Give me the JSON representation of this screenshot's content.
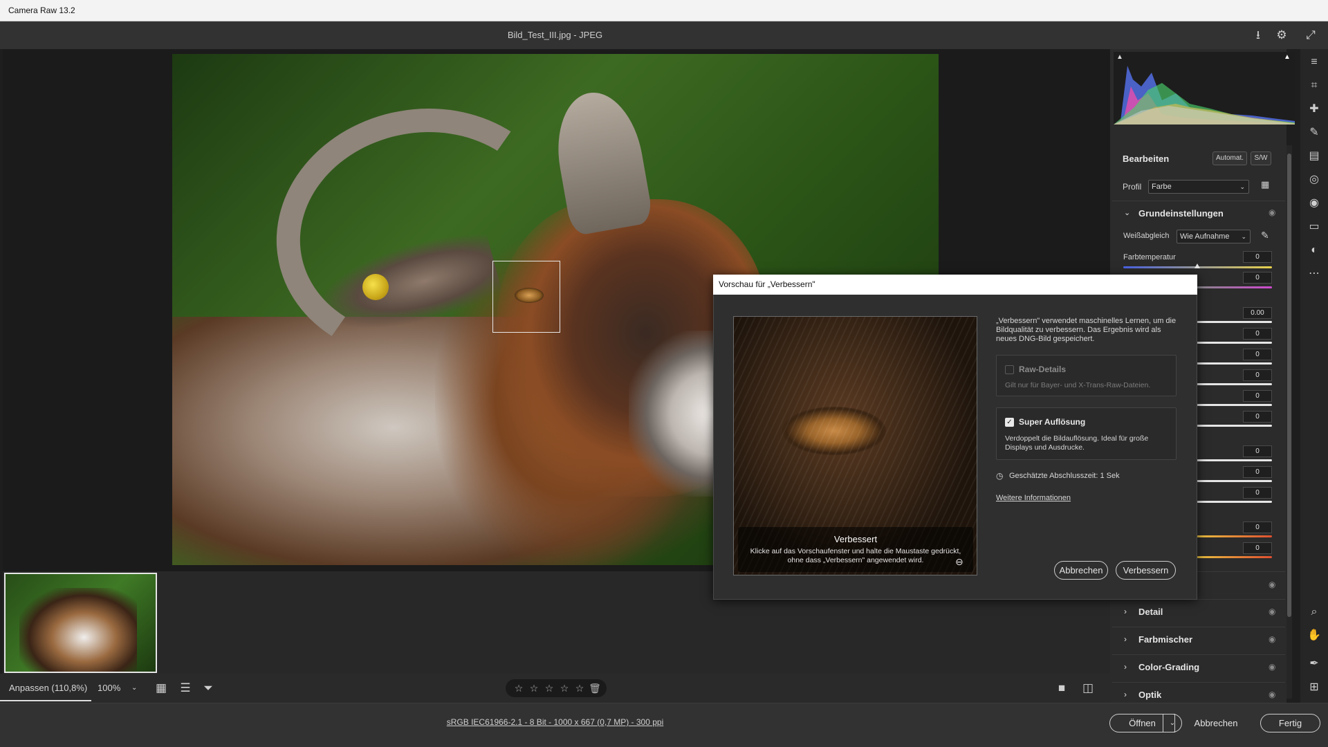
{
  "window": {
    "title": "Camera Raw 13.2"
  },
  "header": {
    "filename": "Bild_Test_III.jpg  -  JPEG",
    "icons": [
      "save-icon",
      "gear-icon",
      "fullscreen-icon"
    ]
  },
  "bottombar": {
    "zoom_fit": "Anpassen (110,8%)",
    "zoom_level": "100%",
    "stars": [
      "☆",
      "☆",
      "☆",
      "☆",
      "☆"
    ]
  },
  "footer": {
    "file_info": "sRGB IEC61966-2.1 - 8 Bit - 1000 x 667 (0,7 MP) - 300 ppi",
    "open_label": "Öffnen",
    "cancel_label": "Abbrechen",
    "done_label": "Fertig"
  },
  "panel": {
    "edit_title": "Bearbeiten",
    "auto_label": "Automat.",
    "bw_label": "S/W",
    "profile_label": "Profil",
    "profile_value": "Farbe",
    "basic_section": "Grundeinstellungen",
    "wb_label": "Weißabgleich",
    "wb_value": "Wie Aufnahme",
    "temp_label": "Farbtemperatur",
    "values": [
      "0",
      "0",
      "0.00",
      "0",
      "0",
      "0",
      "0",
      "0",
      "0",
      "0",
      "0",
      "0",
      "0"
    ],
    "curve_partial": "ve",
    "sections": [
      "Detail",
      "Farbmischer",
      "Color-Grading",
      "Optik"
    ]
  },
  "dialog": {
    "title": "Vorschau für „Verbessern\"",
    "description": "„Verbessern\" verwendet maschinelles Lernen, um die Bildqualität zu verbessern. Das Ergebnis wird als neues DNG-Bild gespeichert.",
    "raw_details_title": "Raw-Details",
    "raw_details_desc": "Gilt nur für Bayer- und X-Trans-Raw-Dateien.",
    "super_res_title": "Super Auflösung",
    "super_res_desc": "Verdoppelt die Bildauflösung. Ideal für große Displays und Ausdrucke.",
    "estimated_time": "Geschätzte Abschlusszeit: 1 Sek",
    "more_info": "Weitere Informationen",
    "preview_caption_title": "Verbessert",
    "preview_caption_body": "Klicke auf das Vorschaufenster und halte die Maustaste gedrückt, ohne dass „Verbessern\" angewendet wird.",
    "cancel_label": "Abbrechen",
    "enhance_label": "Verbessern",
    "raw_details_checked": false,
    "super_res_checked": true
  },
  "colors": {
    "accent": "#e6e6e6",
    "panel_bg": "#2b2b2b",
    "dialog_bg": "#2f2f2f"
  }
}
